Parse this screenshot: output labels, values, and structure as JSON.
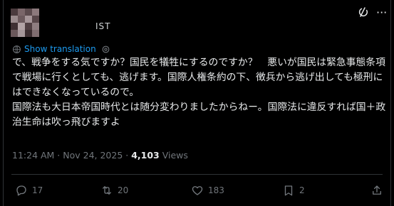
{
  "post": {
    "handle": "IST",
    "show_translation": "Show translation",
    "text": "で、戦争をする気ですか？国民を犠牲にするのですか？　悪いが国民は緊急事態条項で戦場に行くとしても、逃げます。国際人権条約の下、徴兵から逃げ出しても極刑にはできなくなっているので。\n国際法も大日本帝国時代とは随分変わりましたからねー。国際法に違反すれば国＋政治生命は吹っ飛びますよ",
    "timestamp": "11:24 AM · Nov 24, 2025 · ",
    "views_count": "4,103",
    "views_label": " Views"
  },
  "actions": {
    "replies": "17",
    "reposts": "20",
    "likes": "183",
    "bookmarks": "2"
  },
  "colors": {
    "background": "#000000",
    "text": "#e7e9ea",
    "muted": "#71767b",
    "link": "#1d9bf0",
    "divider": "#2f3336"
  },
  "icons": [
    "grok-icon",
    "more-icon",
    "translate-icon",
    "settings-icon",
    "reply-icon",
    "repost-icon",
    "like-icon",
    "bookmark-icon",
    "share-icon"
  ]
}
